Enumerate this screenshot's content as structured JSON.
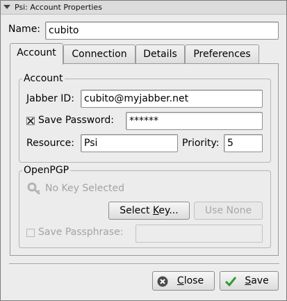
{
  "window": {
    "title": "Psi: Account Properties"
  },
  "name_field": {
    "label": "Name:",
    "value": "cubito"
  },
  "tabs": [
    {
      "label": "Account",
      "active": true
    },
    {
      "label": "Connection",
      "active": false
    },
    {
      "label": "Details",
      "active": false
    },
    {
      "label": "Preferences",
      "active": false
    }
  ],
  "account_group": {
    "title": "Account",
    "jabber_id_label": "Jabber ID:",
    "jabber_id_value": "cubito@myjabber.net",
    "save_password_label": "Save Password:",
    "save_password_checked": true,
    "password_value": "******",
    "resource_label": "Resource:",
    "resource_value": "Psi",
    "priority_label": "Priority:",
    "priority_value": "5"
  },
  "openpgp_group": {
    "title": "OpenPGP",
    "key_status": "No Key Selected",
    "select_key_prefix": "Select ",
    "select_key_mnemonic": "K",
    "select_key_suffix": "ey...",
    "use_none_label": "Use None",
    "save_passphrase_label": "Save Passphrase:",
    "passphrase_value": ""
  },
  "footer": {
    "close_mnemonic": "C",
    "close_rest": "lose",
    "save_mnemonic": "S",
    "save_rest": "ave"
  },
  "colors": {
    "save_check": "#2f9b2f",
    "close_icon_bg": "#4a4a4a"
  },
  "icons": {
    "close": "close-circle-icon",
    "save": "checkmark-icon",
    "key": "key-icon"
  }
}
